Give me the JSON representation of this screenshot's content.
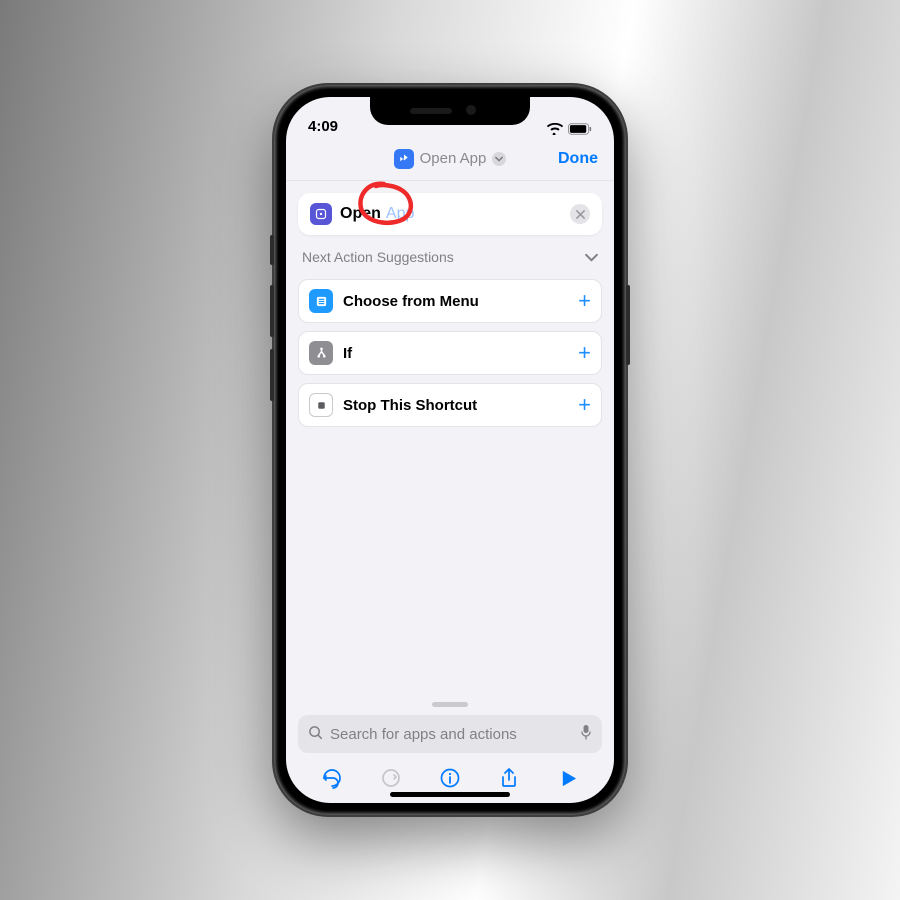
{
  "status": {
    "time": "4:09"
  },
  "nav": {
    "title": "Open App",
    "done": "Done"
  },
  "action_card": {
    "verb": "Open",
    "param": "App"
  },
  "suggestions_header": "Next Action Suggestions",
  "suggestions": [
    {
      "label": "Choose from Menu"
    },
    {
      "label": "If"
    },
    {
      "label": "Stop This Shortcut"
    }
  ],
  "search": {
    "placeholder": "Search for apps and actions"
  }
}
